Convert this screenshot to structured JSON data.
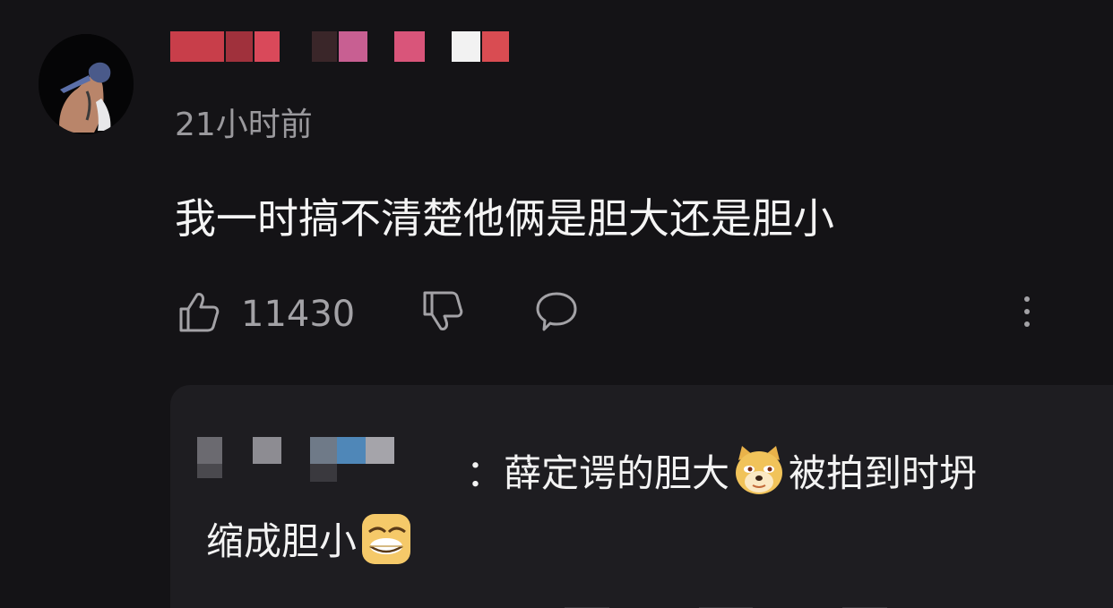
{
  "comment": {
    "timestamp": "21小时前",
    "text": "我一时搞不清楚他俩是胆大还是胆小",
    "like_count": "11430"
  },
  "icons": {
    "like": "thumbs-up-icon",
    "dislike": "thumbs-down-icon",
    "reply": "speech-bubble-icon",
    "more": "more-vertical-icon"
  },
  "reply": {
    "line1_part1": "：薛定谔的胆大",
    "line1_part2": "被拍到时坍",
    "line2": "缩成胆小",
    "emoji1": "doge-emoji",
    "emoji2": "smirk-emoji"
  },
  "colors": {
    "background": "#141316",
    "reply_background": "#1e1d21",
    "secondary_text": "#9a999d",
    "primary_text": "#f4f4f4"
  }
}
